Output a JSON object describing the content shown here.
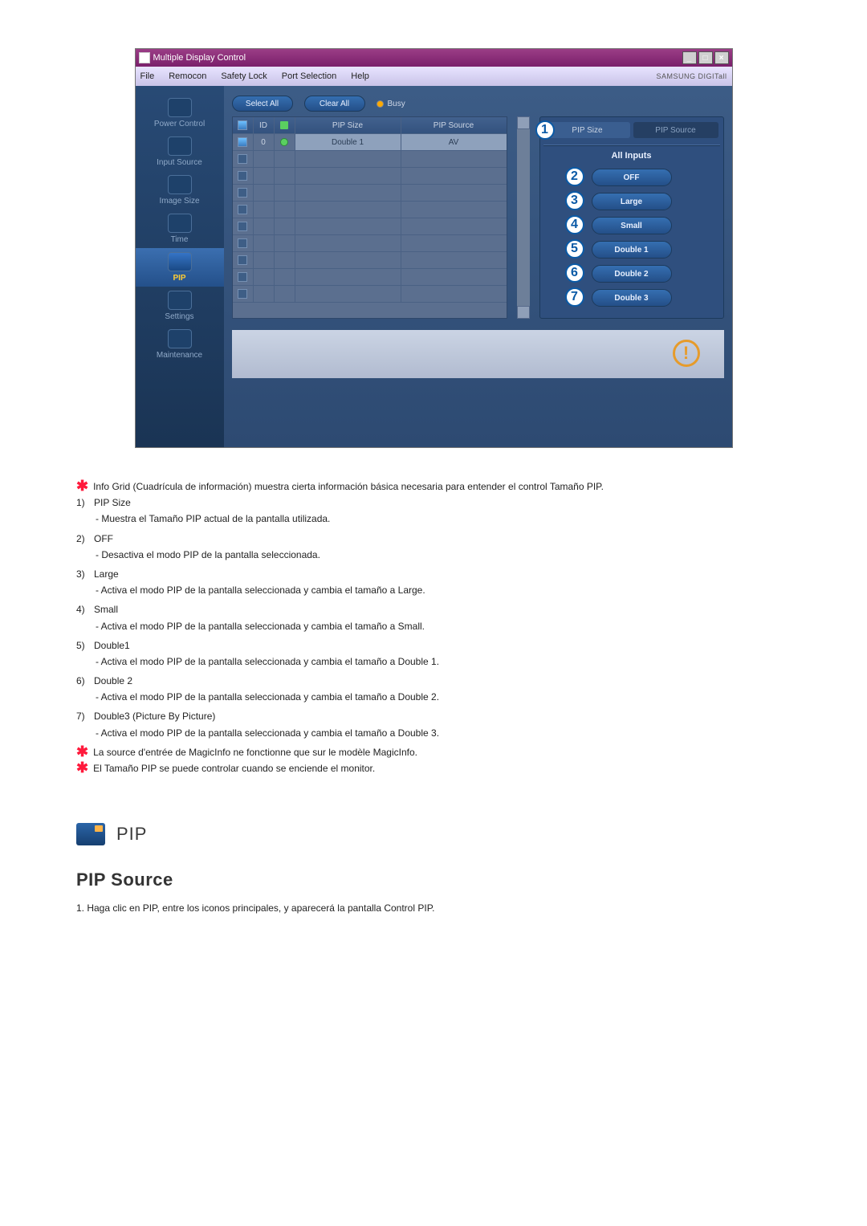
{
  "window": {
    "title": "Multiple Display Control",
    "brand": "SAMSUNG DIGITall"
  },
  "menu": {
    "file": "File",
    "remocon": "Remocon",
    "safety_lock": "Safety Lock",
    "port_selection": "Port Selection",
    "help": "Help"
  },
  "sidebar": {
    "items": [
      {
        "label": "Power Control"
      },
      {
        "label": "Input Source"
      },
      {
        "label": "Image Size"
      },
      {
        "label": "Time"
      },
      {
        "label": "PIP"
      },
      {
        "label": "Settings"
      },
      {
        "label": "Maintenance"
      }
    ]
  },
  "pill": {
    "select_all": "Select All",
    "clear_all": "Clear All",
    "busy": "Busy"
  },
  "grid": {
    "columns": {
      "id": "ID",
      "pip_size": "PIP Size",
      "pip_source": "PIP Source"
    },
    "row0": {
      "id": "0",
      "size": "Double 1",
      "src": "AV"
    }
  },
  "panel": {
    "tab_size": "PIP Size",
    "tab_source": "PIP Source",
    "all_inputs": "All Inputs",
    "btn_off": "OFF",
    "btn_large": "Large",
    "btn_small": "Small",
    "btn_d1": "Double 1",
    "btn_d2": "Double 2",
    "btn_d3": "Double 3"
  },
  "circles": {
    "c1": "1",
    "c2": "2",
    "c3": "3",
    "c4": "4",
    "c5": "5",
    "c6": "6",
    "c7": "7"
  },
  "doc": {
    "intro": "Info Grid (Cuadrícula de información) muestra cierta información básica necesaria para entender el control Tamaño PIP.",
    "n1": "1)",
    "t1": "PIP Size",
    "d1": "- Muestra el Tamaño PIP actual de la pantalla utilizada.",
    "n2": "2)",
    "t2": "OFF",
    "d2": "- Desactiva el modo PIP de la pantalla seleccionada.",
    "n3": "3)",
    "t3": "Large",
    "d3": "- Activa el modo PIP de la pantalla seleccionada y cambia el tamaño a Large.",
    "n4": "4)",
    "t4": "Small",
    "d4": "- Activa el modo PIP de la pantalla seleccionada y cambia el tamaño a Small.",
    "n5": "5)",
    "t5": "Double1",
    "d5": "- Activa el modo PIP de la pantalla seleccionada y cambia el tamaño a Double 1.",
    "n6": "6)",
    "t6": "Double 2",
    "d6": "- Activa el modo PIP de la pantalla seleccionada y cambia el tamaño a Double 2.",
    "n7": "7)",
    "t7": "Double3 (Picture By Picture)",
    "d7": "- Activa el modo PIP de la pantalla seleccionada y cambia el tamaño a Double 3.",
    "note1": "La source d'entrée de MagicInfo ne fonctionne que sur le modèle MagicInfo.",
    "note2": "El Tamaño PIP se puede controlar cuando se enciende el monitor."
  },
  "section": {
    "pip_big": "PIP",
    "pip_source_heading": "PIP Source",
    "pip_source_step": "1.  Haga clic en PIP, entre los iconos principales, y aparecerá la pantalla Control PIP."
  }
}
